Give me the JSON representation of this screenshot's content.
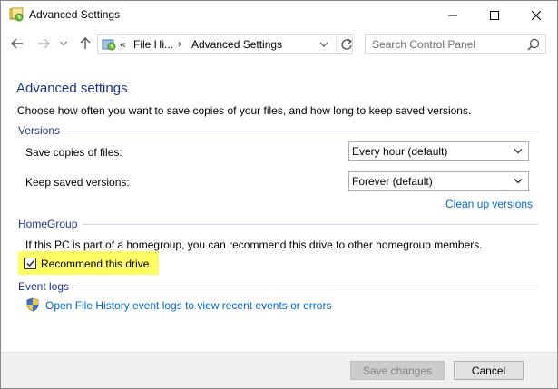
{
  "window": {
    "title": "Advanced Settings"
  },
  "nav": {
    "address_overflow": "«",
    "address_seg1": "File Hi...",
    "address_sep": "›",
    "address_seg2": "Advanced Settings",
    "search_placeholder": "Search Control Panel"
  },
  "content": {
    "title": "Advanced settings",
    "intro": "Choose how often you want to save copies of your files, and how long to keep saved versions.",
    "versions": {
      "label": "Versions",
      "save_copies_label": "Save copies of files:",
      "save_copies_value": "Every hour (default)",
      "keep_versions_label": "Keep saved versions:",
      "keep_versions_value": "Forever (default)",
      "cleanup_link": "Clean up versions"
    },
    "homegroup": {
      "label": "HomeGroup",
      "description": "If this PC is part of a homegroup, you can recommend this drive to other homegroup members.",
      "checkbox_label": "Recommend this drive",
      "checked": true
    },
    "event_logs": {
      "label": "Event logs",
      "link": "Open File History event logs to view recent events or errors"
    }
  },
  "footer": {
    "save_label": "Save changes",
    "cancel_label": "Cancel"
  },
  "colors": {
    "heading": "#1e3287",
    "link": "#0066cc",
    "highlight": "#ffff66"
  }
}
